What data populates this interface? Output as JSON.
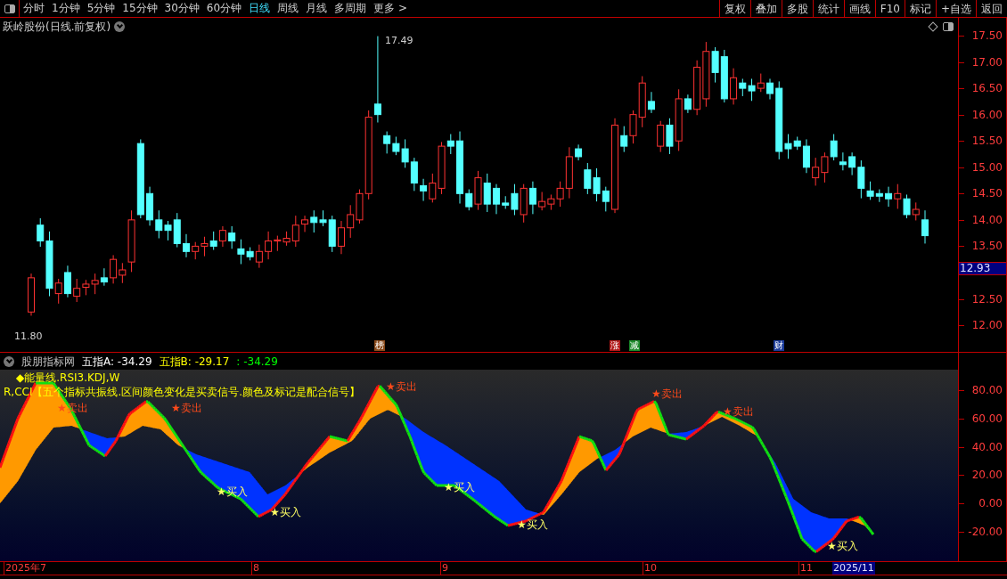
{
  "toolbar": {
    "periods": [
      {
        "label": "分时",
        "selected": false
      },
      {
        "label": "1分钟",
        "selected": false
      },
      {
        "label": "5分钟",
        "selected": false
      },
      {
        "label": "15分钟",
        "selected": false
      },
      {
        "label": "30分钟",
        "selected": false
      },
      {
        "label": "60分钟",
        "selected": false
      },
      {
        "label": "日线",
        "selected": true
      },
      {
        "label": "周线",
        "selected": false
      },
      {
        "label": "月线",
        "selected": false
      },
      {
        "label": "多周期",
        "selected": false
      },
      {
        "label": "更多 >",
        "selected": false
      }
    ],
    "tools": [
      "复权",
      "叠加",
      "多股",
      "统计",
      "画线",
      "F10",
      "标记",
      "+自选",
      "返回"
    ]
  },
  "price_chart": {
    "title": "跃岭股份(日线.前复权)",
    "high_label": "17.49",
    "low_label": "11.80",
    "events": [
      {
        "text": "榜",
        "color": "#8a4a1a"
      },
      {
        "text": "涨",
        "color": "#b01818"
      },
      {
        "text": "减",
        "color": "#1a8a2a"
      },
      {
        "text": "财",
        "color": "#1a3a9a"
      }
    ],
    "axis": [
      "17.50",
      "17.00",
      "16.50",
      "16.00",
      "15.50",
      "15.00",
      "14.50",
      "14.00",
      "13.50",
      "12.50",
      "12.00"
    ],
    "current_price": "12.93"
  },
  "indicator": {
    "source": "股朋指标网",
    "values": [
      {
        "text": "五指A: -34.29",
        "color": "#ffffff"
      },
      {
        "text": "五指B: -29.17",
        "color": "#ffff00"
      },
      {
        "text": ": -34.29",
        "color": "#00ff00"
      }
    ],
    "legend": [
      "◆能量线.RSI3.KDJ,W",
      "R,CCI【五个指标共振线.区间颜色变化是买卖信号.颜色及标记是配合信号】"
    ],
    "signals": [
      {
        "kind": "sell",
        "text": "★卖出"
      },
      {
        "kind": "sell",
        "text": "★卖出"
      },
      {
        "kind": "sell",
        "text": "★卖出"
      },
      {
        "kind": "sell",
        "text": "★卖出"
      },
      {
        "kind": "sell",
        "text": "★卖出"
      },
      {
        "kind": "buy",
        "text": "★买入"
      },
      {
        "kind": "buy",
        "text": "★买入"
      },
      {
        "kind": "buy",
        "text": "★买入"
      },
      {
        "kind": "buy",
        "text": "★买入"
      },
      {
        "kind": "buy",
        "text": "★买入"
      }
    ],
    "axis": [
      "80.00",
      "60.00",
      "40.00",
      "20.00",
      "0.00",
      "-20.00"
    ]
  },
  "date_axis": {
    "labels": [
      "2025年7",
      "8",
      "9",
      "10",
      "11"
    ],
    "current": "2025/11"
  }
}
